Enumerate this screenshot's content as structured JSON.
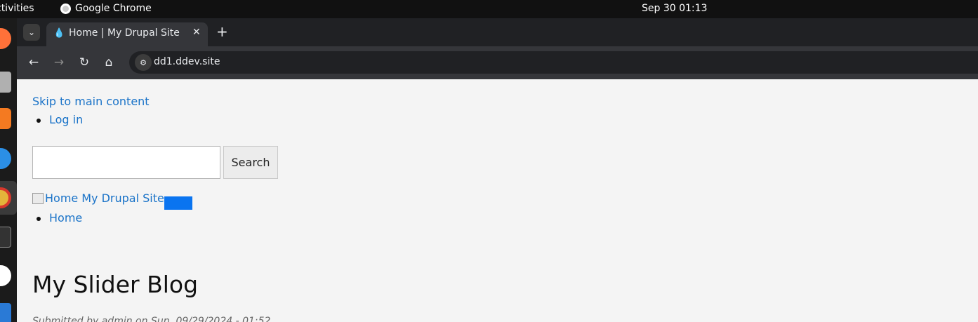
{
  "system": {
    "activities_label": "ctivities",
    "app_name": "Google Chrome",
    "clock": "Sep 30  01:13"
  },
  "browser": {
    "tab_title": "Home | My Drupal Site",
    "url": "dd1.ddev.site"
  },
  "page": {
    "skip_link": "Skip to main content",
    "user_menu": [
      "Log in"
    ],
    "search": {
      "value": "",
      "placeholder": "",
      "button_label": "Search"
    },
    "logo_alt": "Home",
    "site_name": "My Drupal Site",
    "main_menu": [
      "Home"
    ],
    "article_title": "My Slider Blog",
    "submitted": "Submitted by admin on Sun, 09/29/2024 - 01:52"
  },
  "colors": {
    "link": "#1a73c8",
    "accent_block": "#0a74f0"
  }
}
